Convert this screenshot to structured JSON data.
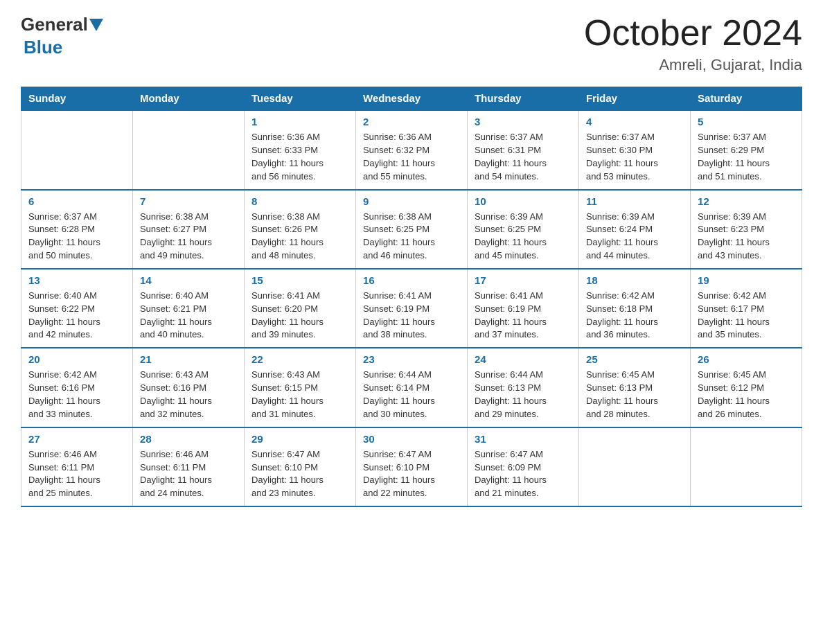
{
  "header": {
    "logo_general": "General",
    "logo_blue": "Blue",
    "month_title": "October 2024",
    "location": "Amreli, Gujarat, India"
  },
  "days_of_week": [
    "Sunday",
    "Monday",
    "Tuesday",
    "Wednesday",
    "Thursday",
    "Friday",
    "Saturday"
  ],
  "weeks": [
    [
      {
        "day": "",
        "info": ""
      },
      {
        "day": "",
        "info": ""
      },
      {
        "day": "1",
        "info": "Sunrise: 6:36 AM\nSunset: 6:33 PM\nDaylight: 11 hours\nand 56 minutes."
      },
      {
        "day": "2",
        "info": "Sunrise: 6:36 AM\nSunset: 6:32 PM\nDaylight: 11 hours\nand 55 minutes."
      },
      {
        "day": "3",
        "info": "Sunrise: 6:37 AM\nSunset: 6:31 PM\nDaylight: 11 hours\nand 54 minutes."
      },
      {
        "day": "4",
        "info": "Sunrise: 6:37 AM\nSunset: 6:30 PM\nDaylight: 11 hours\nand 53 minutes."
      },
      {
        "day": "5",
        "info": "Sunrise: 6:37 AM\nSunset: 6:29 PM\nDaylight: 11 hours\nand 51 minutes."
      }
    ],
    [
      {
        "day": "6",
        "info": "Sunrise: 6:37 AM\nSunset: 6:28 PM\nDaylight: 11 hours\nand 50 minutes."
      },
      {
        "day": "7",
        "info": "Sunrise: 6:38 AM\nSunset: 6:27 PM\nDaylight: 11 hours\nand 49 minutes."
      },
      {
        "day": "8",
        "info": "Sunrise: 6:38 AM\nSunset: 6:26 PM\nDaylight: 11 hours\nand 48 minutes."
      },
      {
        "day": "9",
        "info": "Sunrise: 6:38 AM\nSunset: 6:25 PM\nDaylight: 11 hours\nand 46 minutes."
      },
      {
        "day": "10",
        "info": "Sunrise: 6:39 AM\nSunset: 6:25 PM\nDaylight: 11 hours\nand 45 minutes."
      },
      {
        "day": "11",
        "info": "Sunrise: 6:39 AM\nSunset: 6:24 PM\nDaylight: 11 hours\nand 44 minutes."
      },
      {
        "day": "12",
        "info": "Sunrise: 6:39 AM\nSunset: 6:23 PM\nDaylight: 11 hours\nand 43 minutes."
      }
    ],
    [
      {
        "day": "13",
        "info": "Sunrise: 6:40 AM\nSunset: 6:22 PM\nDaylight: 11 hours\nand 42 minutes."
      },
      {
        "day": "14",
        "info": "Sunrise: 6:40 AM\nSunset: 6:21 PM\nDaylight: 11 hours\nand 40 minutes."
      },
      {
        "day": "15",
        "info": "Sunrise: 6:41 AM\nSunset: 6:20 PM\nDaylight: 11 hours\nand 39 minutes."
      },
      {
        "day": "16",
        "info": "Sunrise: 6:41 AM\nSunset: 6:19 PM\nDaylight: 11 hours\nand 38 minutes."
      },
      {
        "day": "17",
        "info": "Sunrise: 6:41 AM\nSunset: 6:19 PM\nDaylight: 11 hours\nand 37 minutes."
      },
      {
        "day": "18",
        "info": "Sunrise: 6:42 AM\nSunset: 6:18 PM\nDaylight: 11 hours\nand 36 minutes."
      },
      {
        "day": "19",
        "info": "Sunrise: 6:42 AM\nSunset: 6:17 PM\nDaylight: 11 hours\nand 35 minutes."
      }
    ],
    [
      {
        "day": "20",
        "info": "Sunrise: 6:42 AM\nSunset: 6:16 PM\nDaylight: 11 hours\nand 33 minutes."
      },
      {
        "day": "21",
        "info": "Sunrise: 6:43 AM\nSunset: 6:16 PM\nDaylight: 11 hours\nand 32 minutes."
      },
      {
        "day": "22",
        "info": "Sunrise: 6:43 AM\nSunset: 6:15 PM\nDaylight: 11 hours\nand 31 minutes."
      },
      {
        "day": "23",
        "info": "Sunrise: 6:44 AM\nSunset: 6:14 PM\nDaylight: 11 hours\nand 30 minutes."
      },
      {
        "day": "24",
        "info": "Sunrise: 6:44 AM\nSunset: 6:13 PM\nDaylight: 11 hours\nand 29 minutes."
      },
      {
        "day": "25",
        "info": "Sunrise: 6:45 AM\nSunset: 6:13 PM\nDaylight: 11 hours\nand 28 minutes."
      },
      {
        "day": "26",
        "info": "Sunrise: 6:45 AM\nSunset: 6:12 PM\nDaylight: 11 hours\nand 26 minutes."
      }
    ],
    [
      {
        "day": "27",
        "info": "Sunrise: 6:46 AM\nSunset: 6:11 PM\nDaylight: 11 hours\nand 25 minutes."
      },
      {
        "day": "28",
        "info": "Sunrise: 6:46 AM\nSunset: 6:11 PM\nDaylight: 11 hours\nand 24 minutes."
      },
      {
        "day": "29",
        "info": "Sunrise: 6:47 AM\nSunset: 6:10 PM\nDaylight: 11 hours\nand 23 minutes."
      },
      {
        "day": "30",
        "info": "Sunrise: 6:47 AM\nSunset: 6:10 PM\nDaylight: 11 hours\nand 22 minutes."
      },
      {
        "day": "31",
        "info": "Sunrise: 6:47 AM\nSunset: 6:09 PM\nDaylight: 11 hours\nand 21 minutes."
      },
      {
        "day": "",
        "info": ""
      },
      {
        "day": "",
        "info": ""
      }
    ]
  ]
}
